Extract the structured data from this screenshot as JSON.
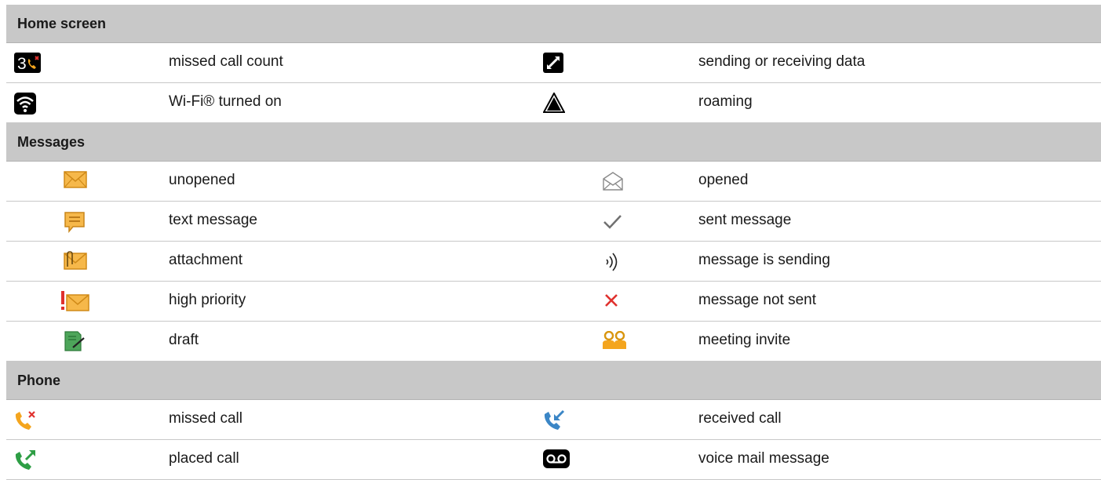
{
  "sections": {
    "home": {
      "header": "Home screen",
      "rows": [
        {
          "left": {
            "icon": "missed-call-count-icon",
            "count": "3",
            "label": "missed call count"
          },
          "right": {
            "icon": "data-transfer-icon",
            "label": "sending or receiving data"
          }
        },
        {
          "left": {
            "icon": "wifi-icon",
            "label": "Wi-Fi® turned on"
          },
          "right": {
            "icon": "roaming-icon",
            "label": "roaming"
          }
        }
      ]
    },
    "messages": {
      "header": "Messages",
      "rows": [
        {
          "left": {
            "icon": "unopened-envelope-icon",
            "label": "unopened"
          },
          "right": {
            "icon": "opened-envelope-icon",
            "label": "opened"
          }
        },
        {
          "left": {
            "icon": "text-message-icon",
            "label": "text message"
          },
          "right": {
            "icon": "checkmark-icon",
            "label": "sent message"
          }
        },
        {
          "left": {
            "icon": "attachment-envelope-icon",
            "label": "attachment"
          },
          "right": {
            "icon": "sending-waves-icon",
            "label": "message is sending"
          }
        },
        {
          "left": {
            "icon": "high-priority-envelope-icon",
            "label": "high priority"
          },
          "right": {
            "icon": "red-x-icon",
            "label": "message not sent"
          }
        },
        {
          "left": {
            "icon": "draft-icon",
            "label": "draft"
          },
          "right": {
            "icon": "meeting-invite-icon",
            "label": "meeting invite"
          }
        }
      ]
    },
    "phone": {
      "header": "Phone",
      "rows": [
        {
          "left": {
            "icon": "missed-call-icon",
            "label": "missed call"
          },
          "right": {
            "icon": "received-call-icon",
            "label": "received call"
          }
        },
        {
          "left": {
            "icon": "placed-call-icon",
            "label": "placed call"
          },
          "right": {
            "icon": "voicemail-icon",
            "label": "voice mail message"
          }
        }
      ]
    }
  },
  "colors": {
    "section_bg": "#c8c8c8",
    "envelope": "#f6b84a",
    "call_orange": "#f4a51e",
    "call_blue": "#3b86c6",
    "call_green": "#2e9e45",
    "alert_red": "#e0312e",
    "draft_green": "#4da55a"
  }
}
